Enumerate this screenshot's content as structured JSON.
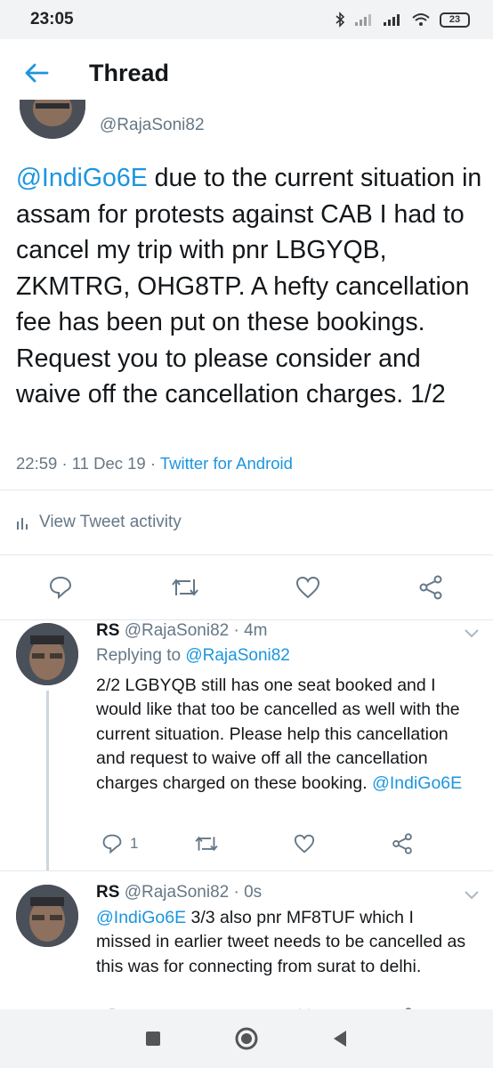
{
  "status_bar": {
    "time": "23:05",
    "battery": "23",
    "icons": [
      "bluetooth-icon",
      "signal-1-icon",
      "signal-2-icon",
      "wifi-icon",
      "battery-icon"
    ]
  },
  "header": {
    "title": "Thread"
  },
  "main_tweet": {
    "handle": "@RajaSoni82",
    "mention": "@IndiGo6E",
    "text": " due to the current situation in assam for protests against CAB I had to cancel my trip with pnr LBGYQB, ZKMTRG, OHG8TP. A hefty cancellation fee has been put on these bookings. Request you to please consider and waive off the cancellation charges. 1/2",
    "time": "22:59",
    "date": "11 Dec 19",
    "source": "Twitter for Android",
    "separator": "·",
    "activity_label": "View Tweet activity"
  },
  "replies": [
    {
      "name": "RS",
      "handle": "@RajaSoni82",
      "age": "4m",
      "replying_prefix": "Replying to ",
      "replying_to": "@RajaSoni82",
      "text": "2/2 LGBYQB still has one seat booked and I would like that too be cancelled as well with the current situation. Please help this cancellation  and request to waive off all the cancellation charges charged on these booking. ",
      "trailing_mention": "@IndiGo6E",
      "reply_count": "1"
    },
    {
      "name": "RS",
      "handle": "@RajaSoni82",
      "age": "0s",
      "leading_mention": "@IndiGo6E",
      "text": " 3/3 also pnr MF8TUF which I missed in earlier tweet needs to be cancelled as this was for connecting from surat to delhi."
    }
  ],
  "colors": {
    "link": "#1b95e0",
    "muted": "#657786",
    "text": "#14171a",
    "divider": "#e1e8ed"
  }
}
